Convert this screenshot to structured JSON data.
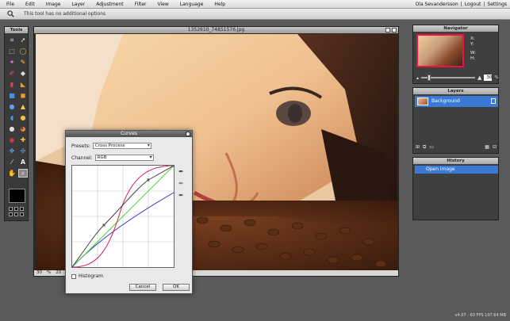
{
  "menubar": {
    "items": [
      "File",
      "Edit",
      "Image",
      "Layer",
      "Adjustment",
      "Filter",
      "View",
      "Language",
      "Help"
    ],
    "user": "Ola Sevandersson",
    "sep1": "|",
    "logout": "Logout",
    "sep2": "|",
    "settings": "Settings"
  },
  "options": {
    "text": "This tool has no additional options",
    "icon": "magnifier-icon"
  },
  "tools": {
    "title": "Tools",
    "icons": [
      "crop-icon",
      "move-icon",
      "marquee-icon",
      "lasso-icon",
      "wand-icon",
      "pencil-icon",
      "brush-icon",
      "clone-icon",
      "eraser-icon",
      "bucket-icon",
      "gradient-icon",
      "shape-icon",
      "blur-icon",
      "sharpen-icon",
      "smudge-icon",
      "sponge-icon",
      "dodge-icon",
      "burn-icon",
      "redeye-icon",
      "spot-icon",
      "pinch-icon",
      "bloat-icon",
      "picker-icon",
      "text-icon",
      "hand-icon",
      "zoom-icon"
    ],
    "active": "zoom-icon"
  },
  "image_window": {
    "title": "1352610_74851576.jpg",
    "zoom": "30",
    "zoom_unit": "%",
    "size_partial": "20"
  },
  "navigator": {
    "title": "Navigator",
    "x_label": "X:",
    "y_label": "Y:",
    "w_label": "W:",
    "h_label": "H:",
    "zoom_value": "30",
    "zoom_level": 0.12
  },
  "layers": {
    "title": "Layers",
    "items": [
      {
        "name": "Background",
        "visible": true
      }
    ],
    "toolbar_icons": [
      "add-layer-icon",
      "duplicate-icon",
      "folder-icon",
      "trash-icon",
      "settings-icon"
    ]
  },
  "history": {
    "title": "History",
    "items": [
      "Open image"
    ]
  },
  "curves": {
    "title": "Curves",
    "presets_label": "Presets:",
    "preset_value": "Cross Process",
    "channel_label": "Channel:",
    "channel_value": "RGB",
    "histogram_label": "Histogram",
    "histogram_checked": false,
    "cancel_label": "Cancel",
    "ok_label": "OK",
    "colors": {
      "rgb": "#444444",
      "red": "#d02050",
      "green": "#50d040",
      "blue": "#3840c8"
    }
  },
  "status": {
    "text": "v4.07 - 60 FPS 197.64 MB"
  }
}
